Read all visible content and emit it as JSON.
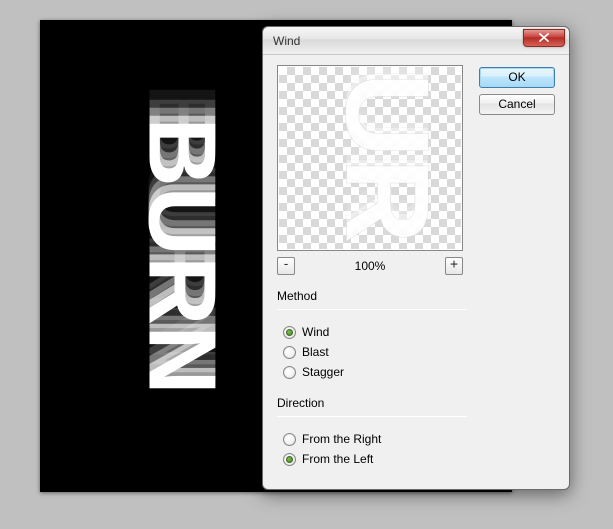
{
  "background": {
    "text": "BURN"
  },
  "dialog": {
    "title": "Wind",
    "buttons": {
      "ok": "OK",
      "cancel": "Cancel"
    },
    "preview": {
      "zoom": "100%",
      "zoom_out": "-",
      "zoom_in": "+"
    },
    "method": {
      "label": "Method",
      "options": {
        "wind": "Wind",
        "blast": "Blast",
        "stagger": "Stagger"
      },
      "selected": "wind"
    },
    "direction": {
      "label": "Direction",
      "options": {
        "right": "From the Right",
        "left": "From the Left"
      },
      "selected": "left"
    }
  }
}
